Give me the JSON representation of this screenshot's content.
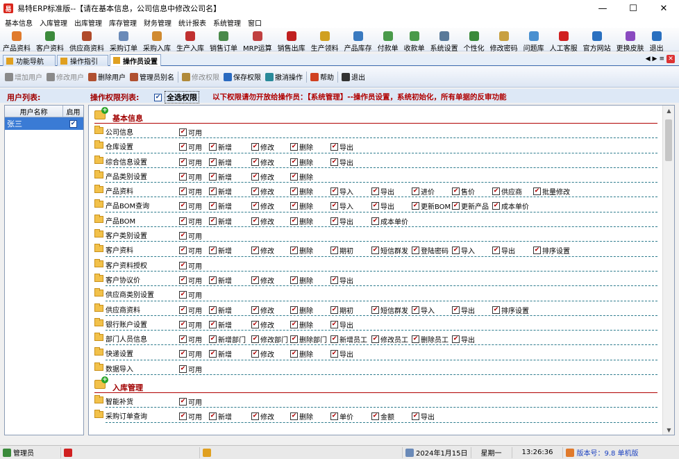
{
  "window": {
    "title": "易特ERP标准版--【请在基本信息，公司信息中修改公司名】",
    "app_icon": "易"
  },
  "menu": [
    "基本信息",
    "入库管理",
    "出库管理",
    "库存管理",
    "财务管理",
    "统计报表",
    "系统管理",
    "窗口"
  ],
  "toolbar": [
    {
      "label": "产品资料",
      "color": "#e07a2c"
    },
    {
      "label": "客户资料",
      "color": "#3c8a3c"
    },
    {
      "label": "供应商资料",
      "color": "#b04a2a"
    },
    {
      "label": "采购订单",
      "color": "#6a8ab8"
    },
    {
      "label": "采购入库",
      "color": "#d08a30"
    },
    {
      "label": "生产入库",
      "color": "#c03030"
    },
    {
      "label": "销售订单",
      "color": "#4a8a4a"
    },
    {
      "label": "MRP运算",
      "color": "#c04040"
    },
    {
      "label": "销售出库",
      "color": "#c02020"
    },
    {
      "label": "生产领料",
      "color": "#d0a020"
    },
    {
      "label": "产品库存",
      "color": "#3a7ac0"
    },
    {
      "label": "付款单",
      "color": "#4a9a4a"
    },
    {
      "label": "收款单",
      "color": "#4a9a4a"
    },
    {
      "label": "系统设置",
      "color": "#5a7a9a"
    },
    {
      "label": "个性化",
      "color": "#3a8a3a"
    },
    {
      "label": "修改密码",
      "color": "#c8a040"
    },
    {
      "label": "问题库",
      "color": "#4a90d0"
    },
    {
      "label": "人工客服",
      "color": "#d02020"
    },
    {
      "label": "官方网站",
      "color": "#2a70c0"
    },
    {
      "label": "更换皮肤",
      "color": "#8a4ac0"
    },
    {
      "label": "退出",
      "color": "#2a70c0"
    }
  ],
  "tabs": [
    "功能导航",
    "操作指引",
    "操作员设置"
  ],
  "actions": [
    {
      "label": "增加用户",
      "disabled": true,
      "color": "#8a8a8a"
    },
    {
      "label": "修改用户",
      "disabled": true,
      "color": "#8a8a8a"
    },
    {
      "label": "删除用户",
      "disabled": false,
      "color": "#b05030"
    },
    {
      "label": "管理员别名",
      "disabled": false,
      "color": "#b05030"
    },
    {
      "label": "修改权限",
      "disabled": true,
      "color": "#b08a3a"
    },
    {
      "label": "保存权限",
      "disabled": false,
      "color": "#2a6ac0"
    },
    {
      "label": "撤消操作",
      "disabled": false,
      "color": "#2a8a9a"
    },
    {
      "label": "帮助",
      "disabled": false,
      "color": "#d04020"
    },
    {
      "label": "退出",
      "disabled": false,
      "color": "#333333"
    }
  ],
  "labels": {
    "user_list": "用户列表:",
    "perm_list": "操作权限列表:",
    "select_all": "全选权限",
    "notice": "以下权限请勿开放给操作员：【系统管理】--操作员设置，系统初始化，所有单据的反审功能"
  },
  "users": {
    "col_name": "用户名称",
    "col_enabled": "启用",
    "rows": [
      {
        "name": "张三",
        "enabled": true
      }
    ]
  },
  "sections": [
    {
      "title": "基本信息",
      "items": [
        {
          "name": "公司信息",
          "perms": [
            "可用"
          ]
        },
        {
          "name": "仓库设置",
          "perms": [
            "可用",
            "新增",
            "修改",
            "删除",
            "导出"
          ]
        },
        {
          "name": "综合信息设置",
          "perms": [
            "可用",
            "新增",
            "修改",
            "删除",
            "导出"
          ]
        },
        {
          "name": "产品类别设置",
          "perms": [
            "可用",
            "新增",
            "修改",
            "删除"
          ]
        },
        {
          "name": "产品资料",
          "perms": [
            "可用",
            "新增",
            "修改",
            "删除",
            "导入",
            "导出",
            "进价",
            "售价",
            "供应商",
            "批量修改"
          ]
        },
        {
          "name": "产品BOM查询",
          "perms": [
            "可用",
            "新增",
            "修改",
            "删除",
            "导入",
            "导出",
            "更新BOM",
            "更新产品",
            "成本单价"
          ]
        },
        {
          "name": "产品BOM",
          "perms": [
            "可用",
            "新增",
            "修改",
            "删除",
            "导出",
            "成本单价"
          ]
        },
        {
          "name": "客户类别设置",
          "perms": [
            "可用"
          ]
        },
        {
          "name": "客户资料",
          "perms": [
            "可用",
            "新增",
            "修改",
            "删除",
            "期初",
            "短信群发",
            "登陆密码",
            "导入",
            "导出",
            "排序设置"
          ]
        },
        {
          "name": "客户资料授权",
          "perms": [
            "可用"
          ]
        },
        {
          "name": "客户协议价",
          "perms": [
            "可用",
            "新增",
            "修改",
            "删除",
            "导出"
          ]
        },
        {
          "name": "供应商类别设置",
          "perms": [
            "可用"
          ]
        },
        {
          "name": "供应商资料",
          "perms": [
            "可用",
            "新增",
            "修改",
            "删除",
            "期初",
            "短信群发",
            "导入",
            "导出",
            "排序设置"
          ]
        },
        {
          "name": "银行账户设置",
          "perms": [
            "可用",
            "新增",
            "修改",
            "删除",
            "导出"
          ]
        },
        {
          "name": "部门人员信息",
          "perms": [
            "可用",
            "新增部门",
            "修改部门",
            "删除部门",
            "新增员工",
            "修改员工",
            "删除员工",
            "导出"
          ]
        },
        {
          "name": "快递设置",
          "perms": [
            "可用",
            "新增",
            "修改",
            "删除",
            "导出"
          ]
        },
        {
          "name": "数据导入",
          "perms": [
            "可用"
          ]
        }
      ]
    },
    {
      "title": "入库管理",
      "items": [
        {
          "name": "智能补货",
          "perms": [
            "可用"
          ]
        },
        {
          "name": "采购订单查询",
          "perms": [
            "可用",
            "新增",
            "修改",
            "删除",
            "单价",
            "金额",
            "导出"
          ]
        }
      ]
    }
  ],
  "status": {
    "user": "管理员",
    "date": "2024年1月15日",
    "weekday": "星期一",
    "time": "13:26:36",
    "version": "版本号：9.8 单机版"
  }
}
